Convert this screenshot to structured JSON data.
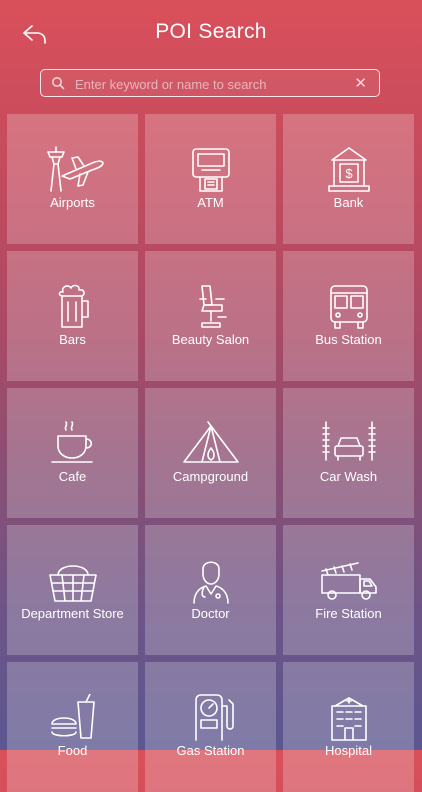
{
  "header": {
    "title": "POI Search",
    "back_icon": "back-arrow-icon"
  },
  "search": {
    "placeholder": "Enter keyword or name to search",
    "value": "",
    "clear_label": "✕"
  },
  "categories": [
    {
      "label": "Airports",
      "icon": "airport-icon"
    },
    {
      "label": "ATM",
      "icon": "atm-icon"
    },
    {
      "label": "Bank",
      "icon": "bank-icon"
    },
    {
      "label": "Bars",
      "icon": "beer-mug-icon"
    },
    {
      "label": "Beauty Salon",
      "icon": "salon-chair-icon"
    },
    {
      "label": "Bus Station",
      "icon": "bus-icon"
    },
    {
      "label": "Cafe",
      "icon": "coffee-cup-icon"
    },
    {
      "label": "Campground",
      "icon": "tent-icon"
    },
    {
      "label": "Car Wash",
      "icon": "car-wash-icon"
    },
    {
      "label": "Department Store",
      "icon": "shopping-basket-icon"
    },
    {
      "label": "Doctor",
      "icon": "doctor-icon"
    },
    {
      "label": "Fire Station",
      "icon": "fire-truck-icon"
    },
    {
      "label": "Food",
      "icon": "fast-food-icon"
    },
    {
      "label": "Gas Station",
      "icon": "gas-pump-icon"
    },
    {
      "label": "Hospital",
      "icon": "hospital-icon"
    }
  ]
}
